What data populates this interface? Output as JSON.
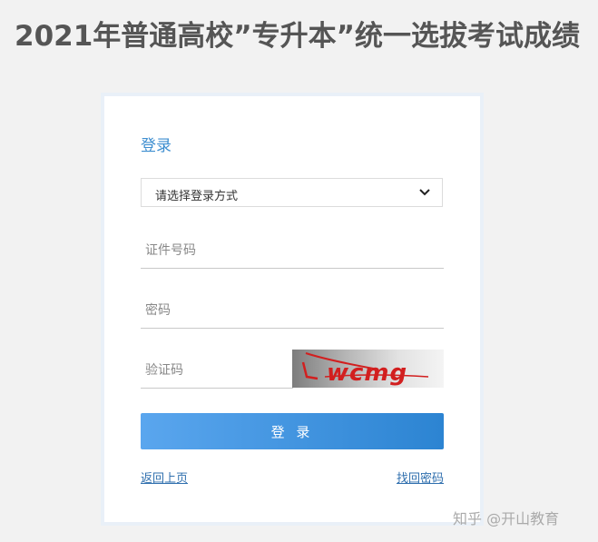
{
  "page": {
    "title": "2021年普通高校”专升本”统一选拔考试成绩"
  },
  "login": {
    "heading": "登录",
    "login_method": {
      "selected": "请选择登录方式"
    },
    "id_field": {
      "placeholder": "证件号码",
      "value": ""
    },
    "password_field": {
      "placeholder": "密码",
      "value": ""
    },
    "captcha_field": {
      "placeholder": "验证码",
      "value": ""
    },
    "captcha_image_text": "wcmg",
    "submit_label": "登 录",
    "back_link": "返回上页",
    "recover_link": "找回密码"
  },
  "watermark": "知乎 @开山教育",
  "colors": {
    "accent": "#3e8ed0",
    "button_start": "#5aa6ee",
    "button_end": "#2c84d2",
    "link": "#2f6fae",
    "captcha_text": "#d21f1f"
  }
}
